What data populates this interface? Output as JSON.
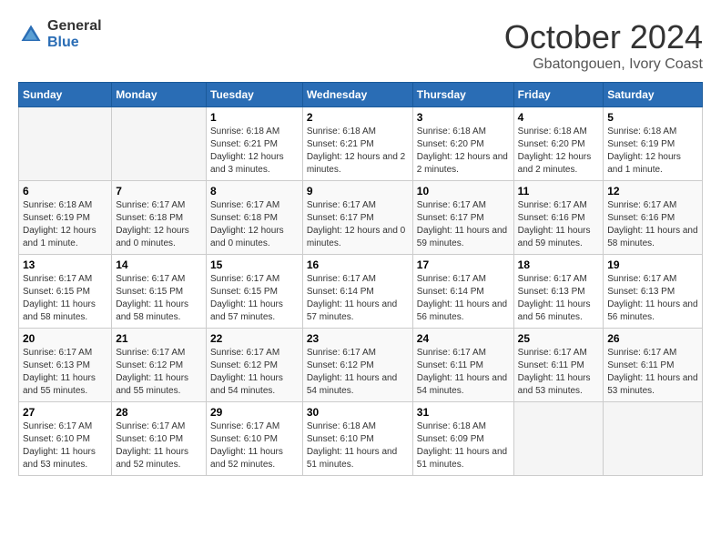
{
  "logo": {
    "general": "General",
    "blue": "Blue"
  },
  "title": "October 2024",
  "subtitle": "Gbatongouen, Ivory Coast",
  "days_of_week": [
    "Sunday",
    "Monday",
    "Tuesday",
    "Wednesday",
    "Thursday",
    "Friday",
    "Saturday"
  ],
  "weeks": [
    [
      {
        "day": "",
        "info": ""
      },
      {
        "day": "",
        "info": ""
      },
      {
        "day": "1",
        "info": "Sunrise: 6:18 AM\nSunset: 6:21 PM\nDaylight: 12 hours and 3 minutes."
      },
      {
        "day": "2",
        "info": "Sunrise: 6:18 AM\nSunset: 6:21 PM\nDaylight: 12 hours and 2 minutes."
      },
      {
        "day": "3",
        "info": "Sunrise: 6:18 AM\nSunset: 6:20 PM\nDaylight: 12 hours and 2 minutes."
      },
      {
        "day": "4",
        "info": "Sunrise: 6:18 AM\nSunset: 6:20 PM\nDaylight: 12 hours and 2 minutes."
      },
      {
        "day": "5",
        "info": "Sunrise: 6:18 AM\nSunset: 6:19 PM\nDaylight: 12 hours and 1 minute."
      }
    ],
    [
      {
        "day": "6",
        "info": "Sunrise: 6:18 AM\nSunset: 6:19 PM\nDaylight: 12 hours and 1 minute."
      },
      {
        "day": "7",
        "info": "Sunrise: 6:17 AM\nSunset: 6:18 PM\nDaylight: 12 hours and 0 minutes."
      },
      {
        "day": "8",
        "info": "Sunrise: 6:17 AM\nSunset: 6:18 PM\nDaylight: 12 hours and 0 minutes."
      },
      {
        "day": "9",
        "info": "Sunrise: 6:17 AM\nSunset: 6:17 PM\nDaylight: 12 hours and 0 minutes."
      },
      {
        "day": "10",
        "info": "Sunrise: 6:17 AM\nSunset: 6:17 PM\nDaylight: 11 hours and 59 minutes."
      },
      {
        "day": "11",
        "info": "Sunrise: 6:17 AM\nSunset: 6:16 PM\nDaylight: 11 hours and 59 minutes."
      },
      {
        "day": "12",
        "info": "Sunrise: 6:17 AM\nSunset: 6:16 PM\nDaylight: 11 hours and 58 minutes."
      }
    ],
    [
      {
        "day": "13",
        "info": "Sunrise: 6:17 AM\nSunset: 6:15 PM\nDaylight: 11 hours and 58 minutes."
      },
      {
        "day": "14",
        "info": "Sunrise: 6:17 AM\nSunset: 6:15 PM\nDaylight: 11 hours and 58 minutes."
      },
      {
        "day": "15",
        "info": "Sunrise: 6:17 AM\nSunset: 6:15 PM\nDaylight: 11 hours and 57 minutes."
      },
      {
        "day": "16",
        "info": "Sunrise: 6:17 AM\nSunset: 6:14 PM\nDaylight: 11 hours and 57 minutes."
      },
      {
        "day": "17",
        "info": "Sunrise: 6:17 AM\nSunset: 6:14 PM\nDaylight: 11 hours and 56 minutes."
      },
      {
        "day": "18",
        "info": "Sunrise: 6:17 AM\nSunset: 6:13 PM\nDaylight: 11 hours and 56 minutes."
      },
      {
        "day": "19",
        "info": "Sunrise: 6:17 AM\nSunset: 6:13 PM\nDaylight: 11 hours and 56 minutes."
      }
    ],
    [
      {
        "day": "20",
        "info": "Sunrise: 6:17 AM\nSunset: 6:13 PM\nDaylight: 11 hours and 55 minutes."
      },
      {
        "day": "21",
        "info": "Sunrise: 6:17 AM\nSunset: 6:12 PM\nDaylight: 11 hours and 55 minutes."
      },
      {
        "day": "22",
        "info": "Sunrise: 6:17 AM\nSunset: 6:12 PM\nDaylight: 11 hours and 54 minutes."
      },
      {
        "day": "23",
        "info": "Sunrise: 6:17 AM\nSunset: 6:12 PM\nDaylight: 11 hours and 54 minutes."
      },
      {
        "day": "24",
        "info": "Sunrise: 6:17 AM\nSunset: 6:11 PM\nDaylight: 11 hours and 54 minutes."
      },
      {
        "day": "25",
        "info": "Sunrise: 6:17 AM\nSunset: 6:11 PM\nDaylight: 11 hours and 53 minutes."
      },
      {
        "day": "26",
        "info": "Sunrise: 6:17 AM\nSunset: 6:11 PM\nDaylight: 11 hours and 53 minutes."
      }
    ],
    [
      {
        "day": "27",
        "info": "Sunrise: 6:17 AM\nSunset: 6:10 PM\nDaylight: 11 hours and 53 minutes."
      },
      {
        "day": "28",
        "info": "Sunrise: 6:17 AM\nSunset: 6:10 PM\nDaylight: 11 hours and 52 minutes."
      },
      {
        "day": "29",
        "info": "Sunrise: 6:17 AM\nSunset: 6:10 PM\nDaylight: 11 hours and 52 minutes."
      },
      {
        "day": "30",
        "info": "Sunrise: 6:18 AM\nSunset: 6:10 PM\nDaylight: 11 hours and 51 minutes."
      },
      {
        "day": "31",
        "info": "Sunrise: 6:18 AM\nSunset: 6:09 PM\nDaylight: 11 hours and 51 minutes."
      },
      {
        "day": "",
        "info": ""
      },
      {
        "day": "",
        "info": ""
      }
    ]
  ]
}
